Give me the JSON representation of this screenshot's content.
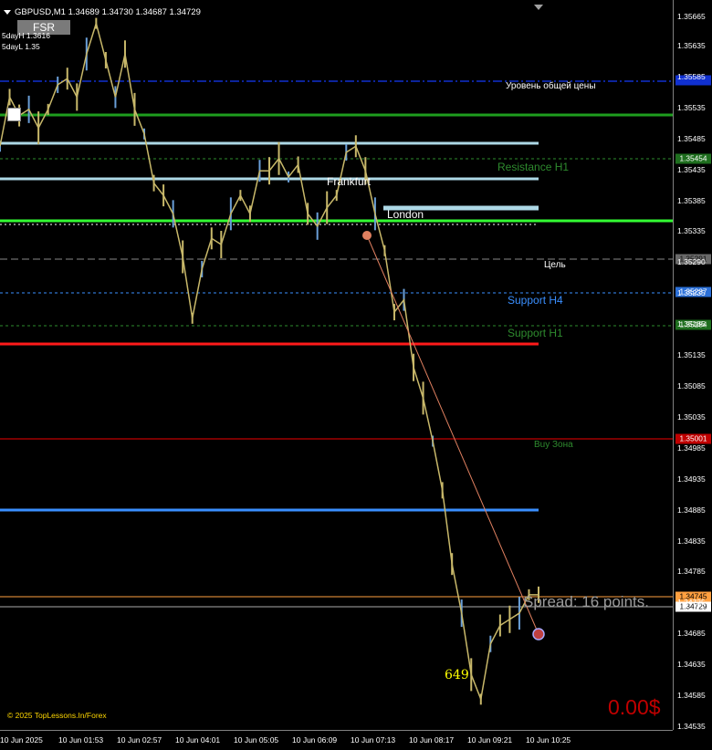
{
  "header": {
    "symbol_line": "GBPUSD,M1  1.34689 1.34730 1.34687 1.34729",
    "fsr_button": "FSR",
    "day_high": "5dayH 1.3616",
    "day_low": "5dayL 1.35"
  },
  "price_axis": {
    "ticks": [
      "1.35635",
      "1.35585",
      "1.35535",
      "1.35485",
      "1.35435",
      "1.35385",
      "1.35335",
      "1.35290",
      "1.35235",
      "1.35185",
      "1.35135",
      "1.35085",
      "1.35035",
      "1.34985",
      "1.34935",
      "1.34885",
      "1.34835",
      "1.34785",
      "1.34735",
      "1.34685",
      "1.34635",
      "1.34585",
      "1.34535"
    ],
    "top_tick": "1.35635"
  },
  "time_axis": {
    "labels": [
      "10 Jun 2025",
      "10 Jun 01:53",
      "10 Jun 02:57",
      "10 Jun 04:01",
      "10 Jun 05:05",
      "10 Jun 06:09",
      "10 Jun 07:13",
      "10 Jun 08:17",
      "10 Jun 09:21",
      "10 Jun 10:25"
    ]
  },
  "levels": {
    "general_price_label": "Уровень общей цены",
    "resistance_h1_label": "Resistance H1",
    "target_label": "Цель",
    "support_h4_label": "Support H4",
    "support_h1_label": "Support H1",
    "buy_zone_label": "Buy Зона"
  },
  "price_tags": {
    "general": "1.35581",
    "resistance_h1": "1.35454",
    "target": "1.35291",
    "support_h4": "1.35237",
    "support_h1": "1.35184",
    "buy_zone": "1.35001",
    "orange": "1.34745",
    "current": "1.34729",
    "top": "1.35665"
  },
  "sessions": {
    "frankfurt": "Frankfurt",
    "london": "London"
  },
  "overlay": {
    "spread": "Spread: 16 points.",
    "counter": "649",
    "profit": "0.00$",
    "copyright": "© 2025 TopLessons.In/Forex"
  },
  "colors": {
    "background": "#000000",
    "candle_line": "#c8b86a",
    "candle_alt": "#6a9fd8",
    "resistance_h1": "#2e8b2e",
    "support_h4": "#3a8fff",
    "support_h1": "#2e8b2e",
    "red_level": "#ff1a1a",
    "buy_zone": "#c00000",
    "lime_level": "#33ff33",
    "dark_green_level": "#1e9e1e",
    "light_blue_level": "#add8e6",
    "blue_level": "#3a8fff",
    "orange_level": "#ffa040",
    "navy_level": "#1030d0"
  },
  "chart_data": {
    "type": "line",
    "title": "",
    "xlabel": "",
    "ylabel": "",
    "ylim": [
      1.3451,
      1.35698
    ],
    "x": [
      "00:48",
      "01:00",
      "01:10",
      "01:20",
      "01:30",
      "01:40",
      "01:53",
      "02:05",
      "02:20",
      "02:35",
      "02:45",
      "02:57",
      "03:05",
      "03:15",
      "03:25",
      "03:35",
      "03:45",
      "04:01",
      "04:10",
      "04:20",
      "04:30",
      "04:40",
      "04:50",
      "05:05",
      "05:15",
      "05:25",
      "05:35",
      "05:45",
      "06:00",
      "06:09",
      "06:20",
      "06:30",
      "06:40",
      "06:50",
      "07:00",
      "07:13",
      "07:25",
      "07:35",
      "07:45",
      "07:55",
      "08:05",
      "08:17",
      "08:25",
      "08:35",
      "08:45",
      "08:55",
      "09:05",
      "09:15",
      "09:21",
      "09:30",
      "09:40",
      "09:50",
      "10:00",
      "10:10",
      "10:20",
      "10:25",
      "10:30"
    ],
    "values": [
      1.3546,
      1.3554,
      1.3551,
      1.3552,
      1.3549,
      1.3552,
      1.3556,
      1.3557,
      1.3554,
      1.3561,
      1.3566,
      1.356,
      1.3554,
      1.3561,
      1.3552,
      1.3548,
      1.354,
      1.3538,
      1.3535,
      1.3528,
      1.3518,
      1.3526,
      1.3531,
      1.353,
      1.3535,
      1.3538,
      1.3535,
      1.3542,
      1.3542,
      1.3544,
      1.3541,
      1.3543,
      1.3535,
      1.3533,
      1.3536,
      1.3538,
      1.3545,
      1.3546,
      1.3542,
      1.3535,
      1.3529,
      1.3519,
      1.3521,
      1.351,
      1.3505,
      1.3498,
      1.349,
      1.3478,
      1.347,
      1.346,
      1.3456,
      1.3465,
      1.3468,
      1.3469,
      1.347,
      1.3473,
      1.3473
    ]
  }
}
